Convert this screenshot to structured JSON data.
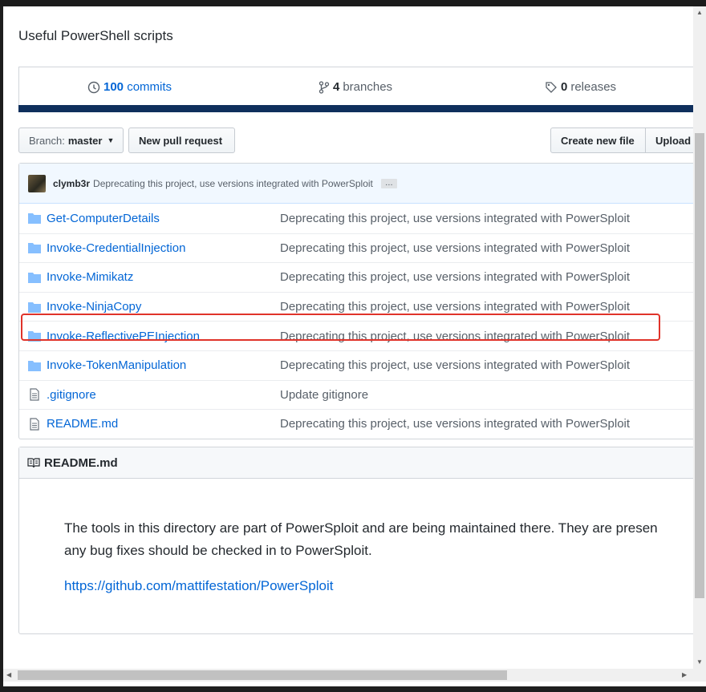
{
  "repo": {
    "description": "Useful PowerShell scripts"
  },
  "summary": {
    "commits_count": "100",
    "commits_label": "commits",
    "branches_count": "4",
    "branches_label": "branches",
    "releases_count": "0",
    "releases_label": "releases"
  },
  "toolbar": {
    "branch_prefix": "Branch:",
    "branch_name": "master",
    "new_pull_request": "New pull request",
    "create_new_file": "Create new file",
    "upload": "Upload"
  },
  "latest_commit": {
    "author": "clymb3r",
    "message": "Deprecating this project, use versions integrated with PowerSploit",
    "ellipsis": "…"
  },
  "files": [
    {
      "type": "folder",
      "name": "Get-ComputerDetails",
      "message": "Deprecating this project, use versions integrated with PowerSploit"
    },
    {
      "type": "folder",
      "name": "Invoke-CredentialInjection",
      "message": "Deprecating this project, use versions integrated with PowerSploit"
    },
    {
      "type": "folder",
      "name": "Invoke-Mimikatz",
      "message": "Deprecating this project, use versions integrated with PowerSploit"
    },
    {
      "type": "folder",
      "name": "Invoke-NinjaCopy",
      "message": "Deprecating this project, use versions integrated with PowerSploit"
    },
    {
      "type": "folder",
      "name": "Invoke-ReflectivePEInjection",
      "message": "Deprecating this project, use versions integrated with PowerSploit"
    },
    {
      "type": "folder",
      "name": "Invoke-TokenManipulation",
      "message": "Deprecating this project, use versions integrated with PowerSploit"
    },
    {
      "type": "file",
      "name": ".gitignore",
      "message": "Update gitignore"
    },
    {
      "type": "file",
      "name": "README.md",
      "message": "Deprecating this project, use versions integrated with PowerSploit"
    }
  ],
  "readme": {
    "title": "README.md",
    "line1": "The tools in this directory are part of PowerSploit and are being maintained there. They are presen",
    "line2": "any bug fixes should be checked in to PowerSploit.",
    "link": "https://github.com/mattifestation/PowerSploit"
  },
  "colors": {
    "link": "#0366d6",
    "highlight": "#e0332a",
    "language_bar": "#0f2f5c"
  }
}
